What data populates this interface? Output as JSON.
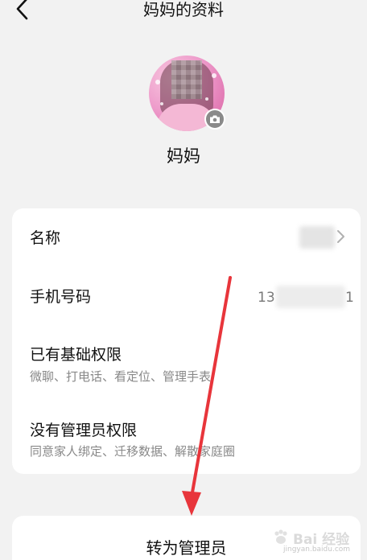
{
  "header": {
    "title": "妈妈的资料"
  },
  "profile": {
    "name": "妈妈"
  },
  "info": {
    "name_label": "名称",
    "phone_label": "手机号码",
    "phone_prefix": "13",
    "phone_suffix": "1",
    "basic_perm_title": "已有基础权限",
    "basic_perm_desc": "微聊、打电话、看定位、管理手表",
    "admin_perm_title": "没有管理员权限",
    "admin_perm_desc": "同意家人绑定、迁移数据、解散家庭圈"
  },
  "actions": {
    "make_admin_label": "转为管理员"
  },
  "watermark": {
    "text": "Bai 经验",
    "url": "jingyan.baidu.com"
  },
  "colors": {
    "background": "#f2f2f2",
    "card": "#ffffff",
    "annotation_arrow": "#e8353b"
  }
}
